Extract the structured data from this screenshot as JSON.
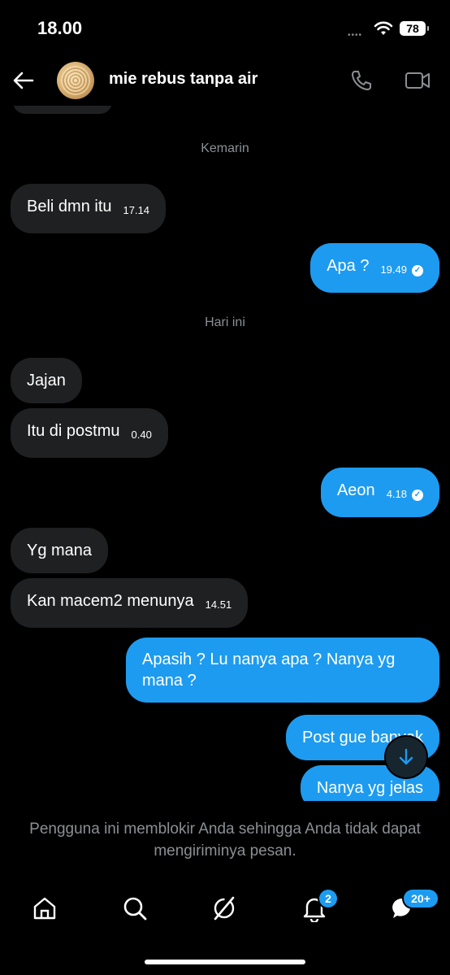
{
  "status_bar": {
    "time": "18.00",
    "signal_dots": "••••",
    "battery": "78"
  },
  "header": {
    "title": "mie rebus tanpa air",
    "avatar": "noodle-avatar"
  },
  "chat": {
    "date_yesterday": "Kemarin",
    "date_today": "Hari ini",
    "messages": [
      {
        "text": "Beli dmn itu",
        "time": "17.14",
        "direction": "in"
      },
      {
        "text": "Apa ?",
        "time": "19.49",
        "direction": "out",
        "read": true
      },
      {
        "text": "Jajan",
        "time": "",
        "direction": "in"
      },
      {
        "text": "Itu di postmu",
        "time": "0.40",
        "direction": "in"
      },
      {
        "text": "Aeon",
        "time": "4.18",
        "direction": "out",
        "read": true
      },
      {
        "text": "Yg mana",
        "time": "",
        "direction": "in"
      },
      {
        "text": "Kan macem2 menunya",
        "time": "14.51",
        "direction": "in"
      },
      {
        "text": "Apasih ? Lu nanya apa ? Nanya yg mana ?",
        "time": "",
        "direction": "out"
      },
      {
        "text": "Post gue banyak",
        "time": "",
        "direction": "out"
      },
      {
        "text": "Nanya yg jelas",
        "time": "",
        "direction": "out"
      }
    ]
  },
  "notice": "Pengguna ini memblokir Anda sehingga Anda tidak dapat mengiriminya pesan.",
  "nav": {
    "notifications_badge": "2",
    "messages_badge": "20+"
  },
  "colors": {
    "accent": "#1d9bf0",
    "incoming_bubble": "#1f2022",
    "background": "#000000",
    "muted": "#8b8f94"
  }
}
